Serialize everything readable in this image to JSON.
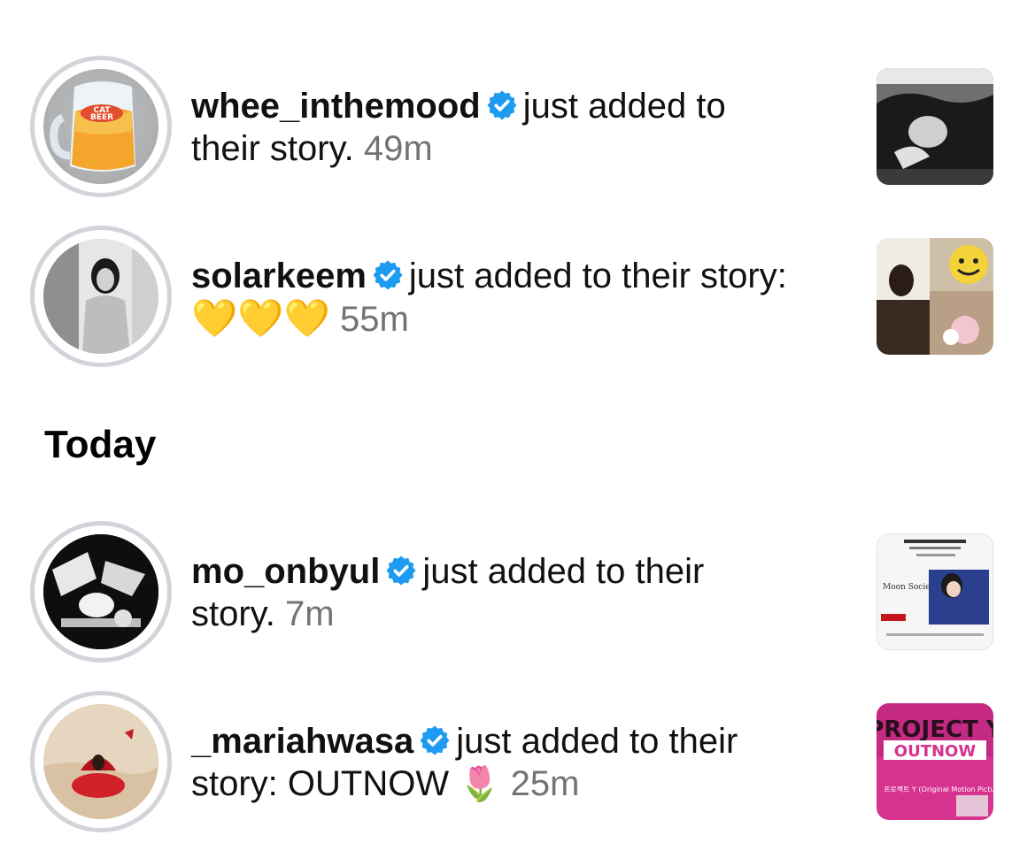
{
  "header": {
    "partial_heading": ""
  },
  "section_today": "Today",
  "notifications": [
    {
      "username": "whee_inthemood",
      "action": "just added to",
      "action_line2": "their story.",
      "time": "49m",
      "avatar_text": "CAT BEER"
    },
    {
      "username": "solarkeem",
      "action": "just added to their story:",
      "hearts": "💛💛💛",
      "time": "55m"
    },
    {
      "username": "mo_onbyul",
      "action": "just added to their",
      "action_line2": "story.",
      "time": "7m",
      "thumb_text": "Moon Society"
    },
    {
      "username": "_mariahwasa",
      "action": "just added to their",
      "action_line2": "story: OUTNOW",
      "emoji": "🌷",
      "time": "25m",
      "thumb_text_1": "PROJECT Y",
      "thumb_text_2": "OUTNOW",
      "thumb_text_3": "프로젝트 Y (Original Motion Picture..."
    }
  ],
  "colors": {
    "verified": "#1d9bf0",
    "time": "#737373",
    "ring": "#d3d4da"
  }
}
